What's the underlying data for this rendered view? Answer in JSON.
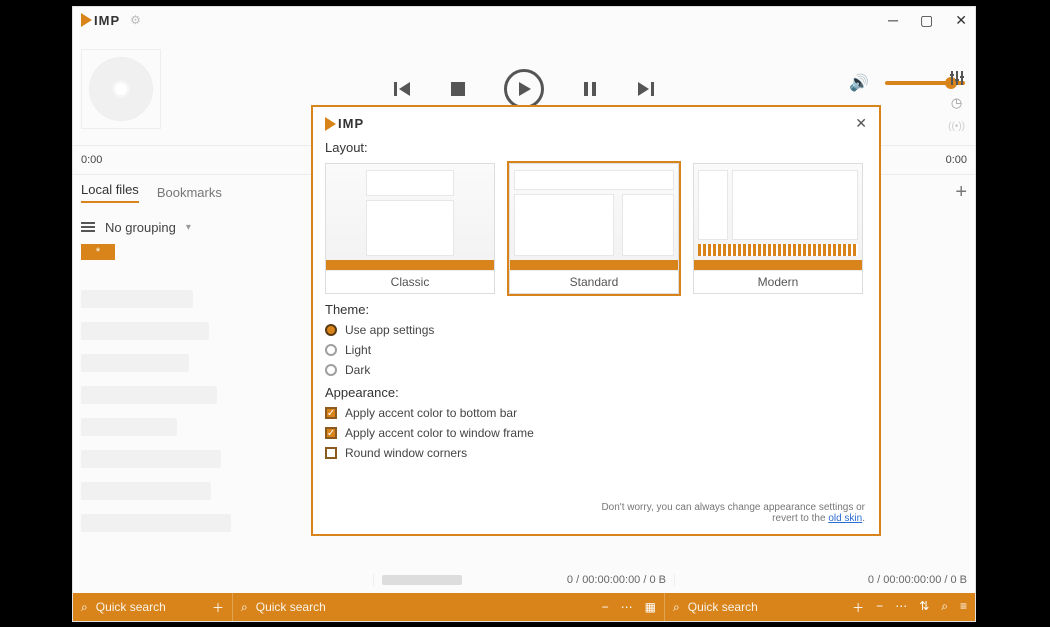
{
  "titlebar": {
    "brand": "IMP"
  },
  "seek": {
    "left": "0:00",
    "right": "0:00"
  },
  "tabs": {
    "local": "Local files",
    "bookmarks": "Bookmarks"
  },
  "grouping": {
    "label": "No grouping"
  },
  "chip": {
    "star": "*"
  },
  "minibar": {
    "stats1": "0 / 00:00:00:00 / 0 B",
    "stats2": "0 / 00:00:00:00 / 0 B"
  },
  "bottombar": {
    "search_placeholder": "Quick search",
    "segments": {
      "s1": "Quick search",
      "s2": "Quick search",
      "s3": "Quick search"
    }
  },
  "dialog": {
    "brand": "IMP",
    "layout_label": "Layout:",
    "layouts": {
      "classic": "Classic",
      "standard": "Standard",
      "modern": "Modern"
    },
    "theme_label": "Theme:",
    "themes": {
      "app": "Use app settings",
      "light": "Light",
      "dark": "Dark"
    },
    "appearance_label": "Appearance:",
    "appearance": {
      "accent_bottom": "Apply accent color to bottom bar",
      "accent_frame": "Apply accent color to window frame",
      "round_corners": "Round window corners"
    },
    "hint_pre": "Don't worry, you can always change appearance settings or revert to the ",
    "hint_link": "old skin",
    "hint_post": "."
  },
  "colors": {
    "accent": "#d8841a"
  }
}
